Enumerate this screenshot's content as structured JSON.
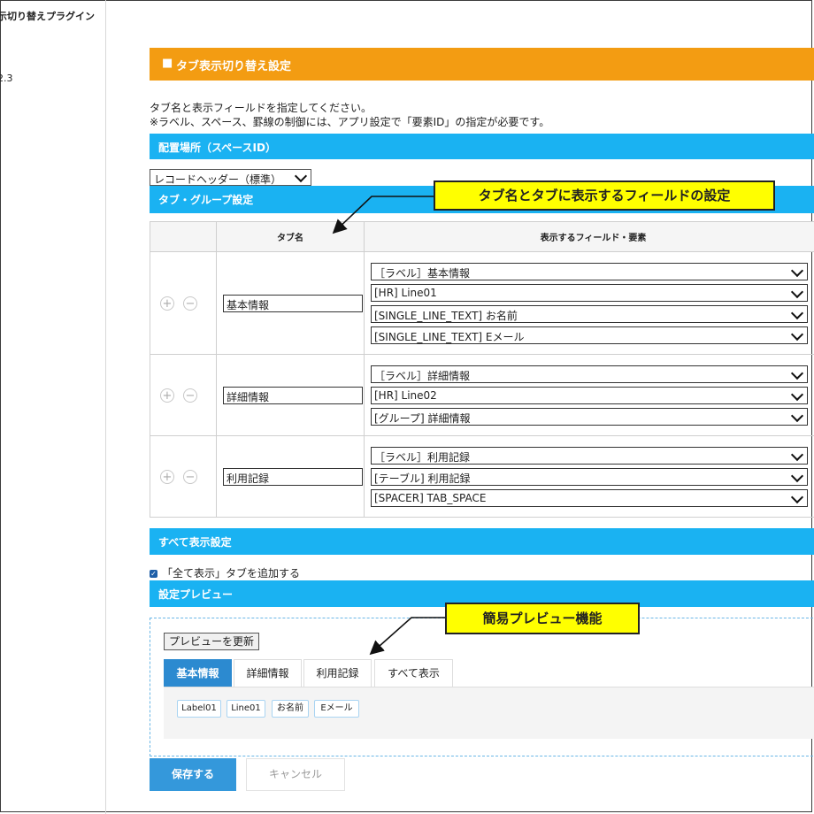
{
  "sidebar": {
    "title": "示切り替えプラグイン",
    "version": "2.3"
  },
  "header": {
    "bullet": "■",
    "title": "タブ表示切り替え設定"
  },
  "description": {
    "line1": "タブ名と表示フィールドを指定してください。",
    "line2": "※ラベル、スペース、罫線の制御には、アプリ設定で「要素ID」の指定が必要です。"
  },
  "space_section": {
    "title": "配置場所（スペースID）",
    "selected": "レコードヘッダー（標準）"
  },
  "tab_group": {
    "title": "タブ・グループ設定",
    "col_tab_name": "タブ名",
    "col_fields": "表示するフィールド・要素",
    "plus_icon": "+",
    "minus_icon": "−",
    "rows": [
      {
        "name": "基本情報",
        "fields": [
          "［ラベル］基本情報",
          "[HR] Line01",
          "[SINGLE_LINE_TEXT] お名前",
          "[SINGLE_LINE_TEXT] Eメール"
        ]
      },
      {
        "name": "詳細情報",
        "fields": [
          "［ラベル］詳細情報",
          "[HR] Line02",
          "[グループ] 詳細情報"
        ]
      },
      {
        "name": "利用記録",
        "fields": [
          "［ラベル］利用記録",
          "[テーブル] 利用記録",
          "[SPACER] TAB_SPACE"
        ]
      }
    ]
  },
  "show_all": {
    "title": "すべて表示設定",
    "checkbox_label": "「全て表示」タブを追加する",
    "checked": true
  },
  "preview": {
    "title": "設定プレビュー",
    "refresh_button": "プレビューを更新",
    "tabs": [
      "基本情報",
      "詳細情報",
      "利用記録",
      "すべて表示"
    ],
    "chips": [
      "Label01",
      "Line01",
      "お名前",
      "Eメール"
    ]
  },
  "actions": {
    "save": "保存する",
    "cancel": "キャンセル"
  },
  "annotations": {
    "callout1": "タブ名とタブに表示するフィールドの設定",
    "callout2": "簡易プレビュー機能"
  },
  "colors": {
    "orange": "#f39c12",
    "section_blue": "#1ab2f2",
    "save_blue": "#3498db",
    "callout_yellow": "#ffff00"
  }
}
